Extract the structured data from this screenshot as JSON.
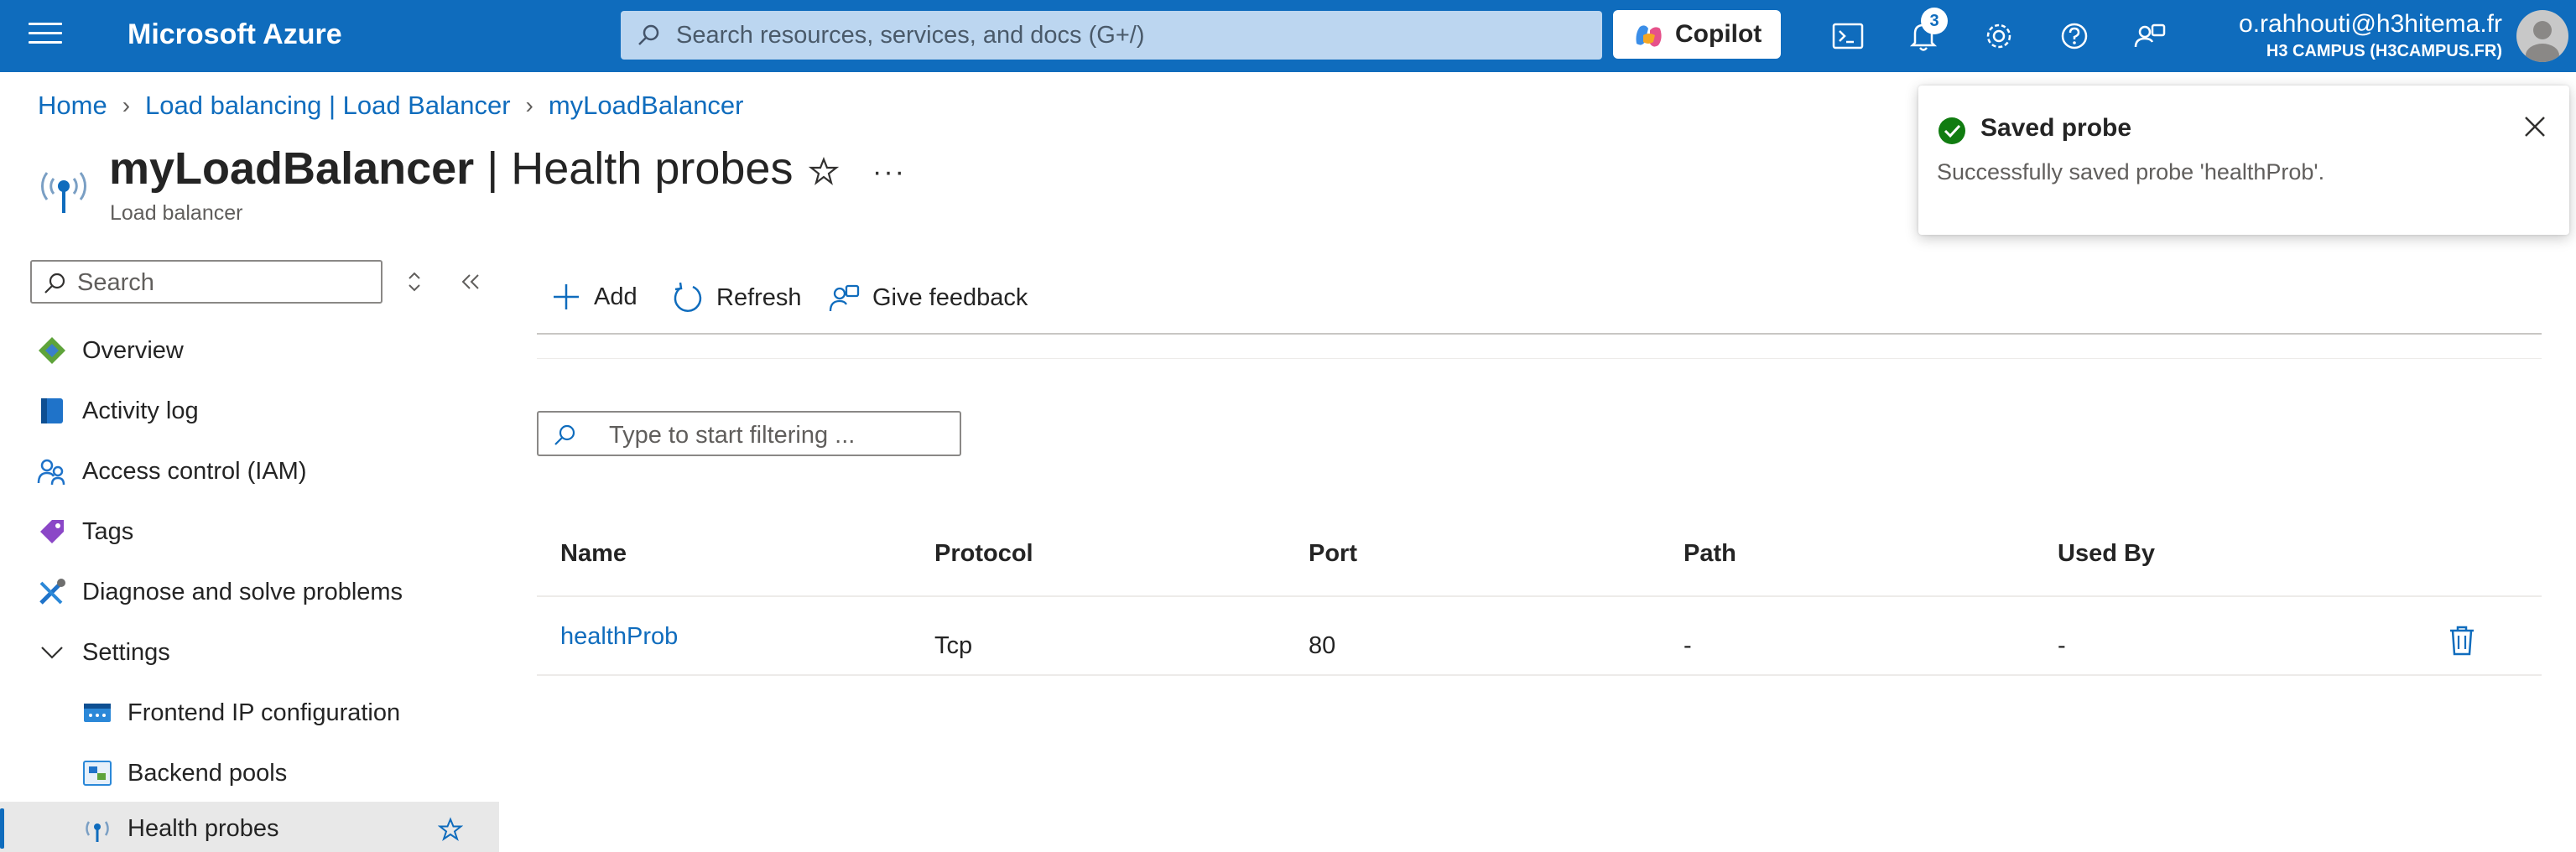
{
  "topbar": {
    "brand": "Microsoft Azure",
    "search_placeholder": "Search resources, services, and docs (G+/)",
    "copilot_label": "Copilot",
    "notification_count": "3",
    "account_email": "o.rahhouti@h3hitema.fr",
    "account_tenant": "H3 CAMPUS (H3CAMPUS.FR)",
    "icons": [
      "cloud-shell-icon",
      "bell-icon",
      "gear-icon",
      "help-icon",
      "feedback-icon"
    ]
  },
  "breadcrumb": {
    "items": [
      "Home",
      "Load balancing | Load Balancer",
      "myLoadBalancer"
    ]
  },
  "header": {
    "resource_name": "myLoadBalancer",
    "separator": "|",
    "blade_name": "Health probes",
    "subtitle": "Load balancer",
    "more_label": "···"
  },
  "sidebar": {
    "search_placeholder": "Search",
    "items": [
      {
        "label": "Overview",
        "icon": "overview-icon"
      },
      {
        "label": "Activity log",
        "icon": "activity-log-icon"
      },
      {
        "label": "Access control (IAM)",
        "icon": "iam-icon"
      },
      {
        "label": "Tags",
        "icon": "tag-icon"
      },
      {
        "label": "Diagnose and solve problems",
        "icon": "wrench-icon"
      },
      {
        "label": "Settings",
        "icon": "chevron-down-icon"
      },
      {
        "label": "Frontend IP configuration",
        "icon": "frontend-ip-icon"
      },
      {
        "label": "Backend pools",
        "icon": "backend-pool-icon"
      },
      {
        "label": "Health probes",
        "icon": "health-probe-icon"
      }
    ]
  },
  "commandbar": {
    "add_label": "Add",
    "refresh_label": "Refresh",
    "feedback_label": "Give feedback"
  },
  "filter": {
    "placeholder": "Type to start filtering ..."
  },
  "table": {
    "columns": [
      "Name",
      "Protocol",
      "Port",
      "Path",
      "Used By"
    ],
    "rows": [
      {
        "name": "healthProb",
        "protocol": "Tcp",
        "port": "80",
        "path": "-",
        "used_by": "-"
      }
    ]
  },
  "toast": {
    "title": "Saved probe",
    "message": "Successfully saved probe 'healthProb'.",
    "status_color": "#107c10"
  },
  "colors": {
    "accent": "#0f6cbd",
    "link": "#0f6cbd"
  }
}
